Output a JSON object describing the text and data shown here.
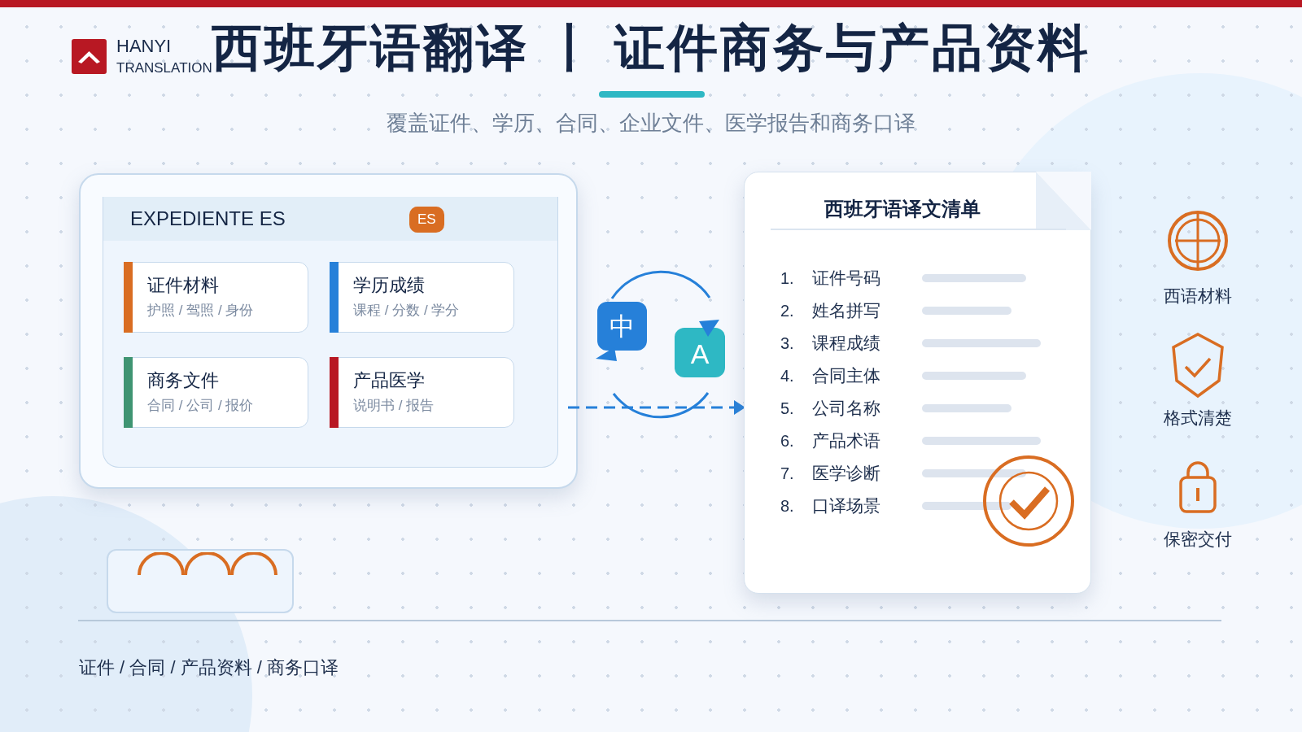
{
  "brand": {
    "name": "HANYI",
    "tagline": "TRANSLATION"
  },
  "title": "西班牙语翻译 丨 证件商务与产品资料",
  "subtitle": "覆盖证件、学历、合同、企业文件、医学报告和商务口译",
  "file_card": {
    "title": "EXPEDIENTE ES",
    "badge": "ES",
    "categories": [
      {
        "title": "证件材料",
        "subtitle": "护照 / 驾照 / 身份",
        "color": "#d96d22"
      },
      {
        "title": "学历成绩",
        "subtitle": "课程 / 分数 / 学分",
        "color": "#2680d9"
      },
      {
        "title": "商务文件",
        "subtitle": "合同 / 公司 / 报价",
        "color": "#3f9472"
      },
      {
        "title": "产品医学",
        "subtitle": "说明书 / 报告",
        "color": "#b81823"
      }
    ]
  },
  "translate_icon": {
    "source": "中",
    "target": "A"
  },
  "document": {
    "title": "西班牙语译文清单",
    "items": [
      {
        "number": "1.",
        "label": "证件号码"
      },
      {
        "number": "2.",
        "label": "姓名拼写"
      },
      {
        "number": "3.",
        "label": "课程成绩"
      },
      {
        "number": "4.",
        "label": "合同主体"
      },
      {
        "number": "5.",
        "label": "公司名称"
      },
      {
        "number": "6.",
        "label": "产品术语"
      },
      {
        "number": "7.",
        "label": "医学诊断"
      },
      {
        "number": "8.",
        "label": "口译场景"
      }
    ]
  },
  "features": [
    {
      "kind": "globe",
      "label": "西语材料"
    },
    {
      "kind": "shield",
      "label": "格式清楚"
    },
    {
      "kind": "lock",
      "label": "保密交付"
    }
  ],
  "footer": "证件 / 合同 / 产品资料 / 商务口译"
}
